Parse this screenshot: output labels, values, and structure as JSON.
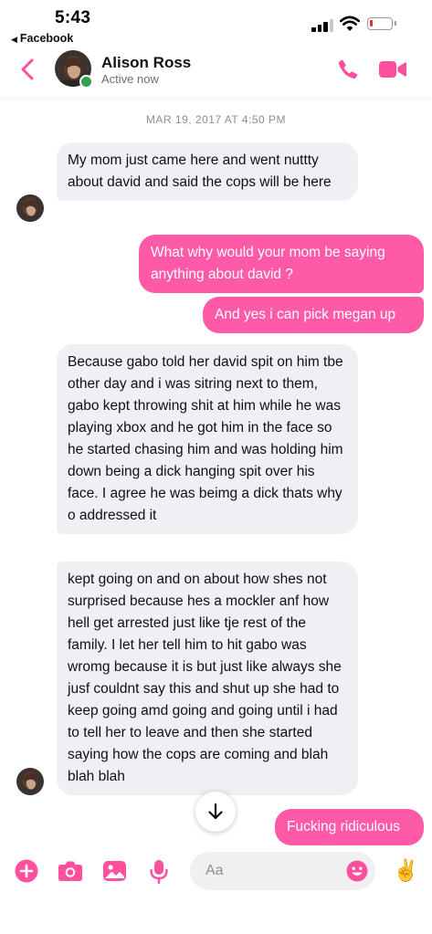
{
  "status_bar": {
    "time": "5:43",
    "back_app": "Facebook"
  },
  "header": {
    "contact_name": "Alison Ross",
    "contact_status": "Active now"
  },
  "conversation": {
    "timestamp": "MAR 19, 2017 AT 4:50 PM",
    "messages": [
      {
        "from": "them",
        "text": "My mom just came here and went nuttty about david and said the cops will be here"
      },
      {
        "from": "me",
        "text": "What why would your mom be saying anything about david ?"
      },
      {
        "from": "me",
        "text": "And yes i can pick megan up"
      },
      {
        "from": "them",
        "text": "Because gabo told her david spit on him tbe other day and i was sitring next to them, gabo kept throwing shit at him while he was playing xbox and he got him in the face so he started chasing him and was holding him down being a dick hanging spit over his face. I agree he was beimg a dick thats why o addressed it"
      },
      {
        "from": "them",
        "text": "kept going on and on about how shes not surprised because hes a mockler anf how hell get arrested just like tje rest of the family. I let her tell him to hit gabo was wromg because it is but just like always she jusf couldnt say this and shut up she had to keep going amd going and going until i had to tell her to leave and then she started saying how the cops are coming and blah blah blah"
      },
      {
        "from": "me",
        "text": "Fucking ridiculous"
      }
    ]
  },
  "composer": {
    "placeholder": "Aa",
    "like_emoji": "✌️"
  },
  "colors": {
    "accent": "#ff4f9f",
    "outgoing_bubble": "#ff5aa8",
    "incoming_bubble": "#efeff4",
    "online": "#31a24c"
  }
}
